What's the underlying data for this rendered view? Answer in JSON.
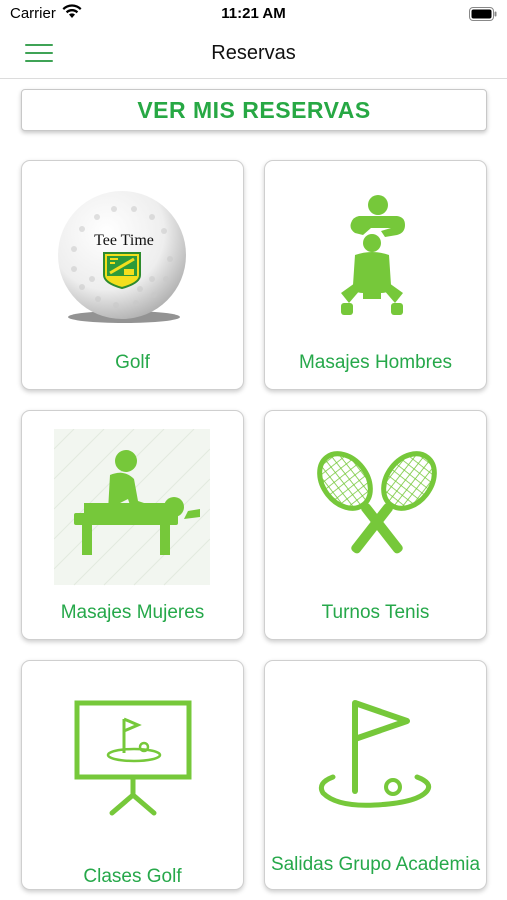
{
  "status": {
    "carrier": "Carrier",
    "time": "11:21 AM"
  },
  "header": {
    "title": "Reservas"
  },
  "view_reservations_label": "VER MIS RESERVAS",
  "golf_ball_text": "Tee Time",
  "cards": [
    {
      "label": "Golf"
    },
    {
      "label": "Masajes Hombres"
    },
    {
      "label": "Masajes Mujeres"
    },
    {
      "label": "Turnos Tenis"
    },
    {
      "label": "Clases Golf"
    },
    {
      "label": "Salidas Grupo Academia"
    }
  ],
  "colors": {
    "accent_green": "#26a84a",
    "icon_green": "#76c83a",
    "hamburger_green": "#3fa356"
  },
  "icons": [
    "menu-icon",
    "golf-ball-icon",
    "massage-men-icon",
    "massage-women-icon",
    "tennis-rackets-icon",
    "golf-class-icon",
    "golf-flag-icon"
  ]
}
